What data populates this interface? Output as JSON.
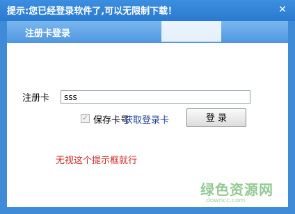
{
  "window": {
    "title": "提示:您已经登录软件了,可以无限制下载！",
    "close_label": "✕"
  },
  "header": {
    "title": "注册卡登录"
  },
  "form": {
    "card_label": "注册卡",
    "card_value": "sss",
    "save_checkbox_label": "保存卡号",
    "save_checked": true,
    "get_card_link": "获取登录卡",
    "login_button": "登  录"
  },
  "hint_text": "无视这个提示框就行",
  "watermark": {
    "main": "绿色资源网",
    "sub": "downcc.com"
  },
  "colors": {
    "titlebar": "#2f7fd1",
    "header": "#6aaeec",
    "hint": "#d02a2a",
    "link": "#1f3f9a",
    "watermark": "#3c9e3c"
  }
}
